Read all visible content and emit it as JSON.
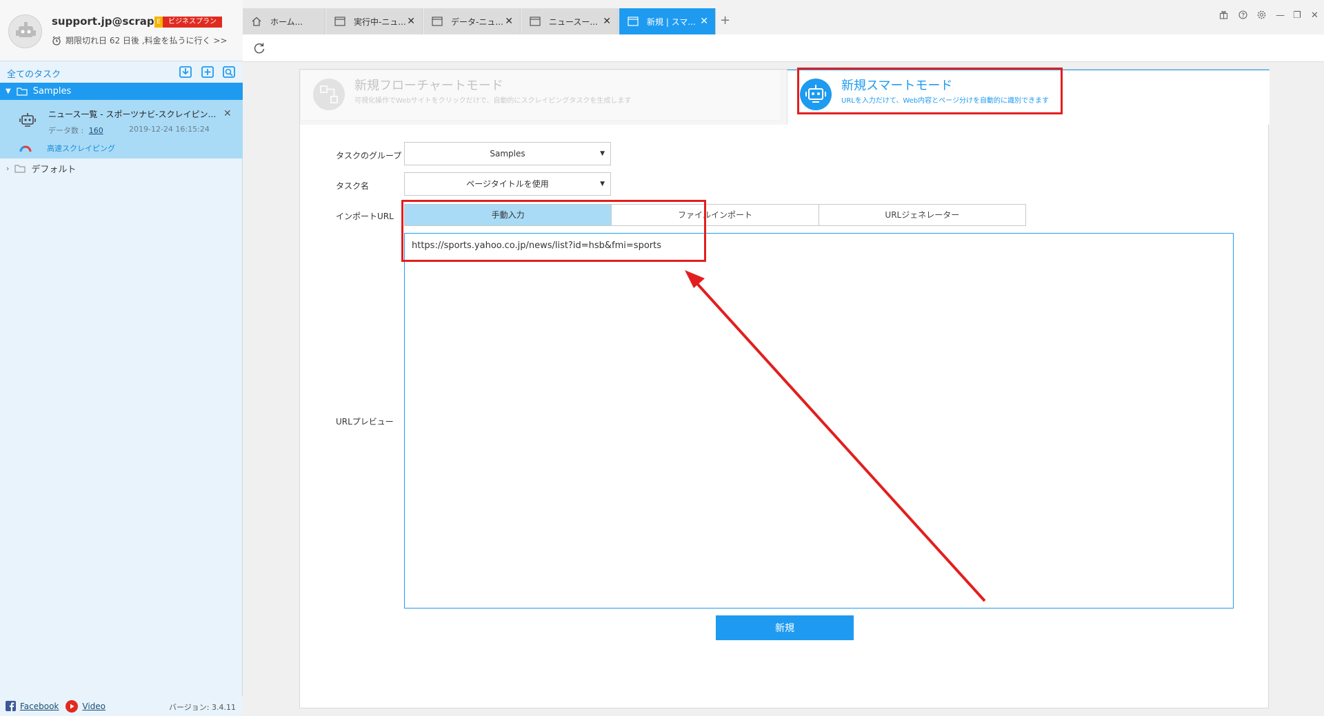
{
  "account": {
    "email": "support.jp@scrap…",
    "plan_letter": "E",
    "plan": "ビジネスプラン",
    "expiry": "期限切れ日 62 日後 ,料金を払うに行く >>"
  },
  "sidebar": {
    "all_tasks": "全てのタスク",
    "groups": [
      {
        "label": "Samples"
      },
      {
        "label": "デフォルト"
      }
    ],
    "task": {
      "title": "ニュース一覧 - スポーツナビ-スクレイピン…",
      "data_label": "データ数 :",
      "data_count": "160",
      "date": "2019-12-24 16:15:24",
      "speed": "高速スクレイピング"
    },
    "footer": {
      "facebook": "Facebook",
      "video": "Video",
      "version": "バージョン: 3.4.11"
    }
  },
  "tabs": [
    {
      "label": "ホーム..."
    },
    {
      "label": "実行中-ニュ..."
    },
    {
      "label": "データ-ニュ..."
    },
    {
      "label": "ニュースー..."
    },
    {
      "label": "新規 | スマ..."
    }
  ],
  "modes": {
    "flow": {
      "title": "新規フローチャートモード",
      "desc": "可視化操作でWebサイトをクリックだけで、自動的にスクレイピングタスクを生成します"
    },
    "smart": {
      "title": "新規スマートモード",
      "desc": "URLを入力だけて、Web内容とページ分けを自動的に識別できます"
    }
  },
  "form": {
    "group_label": "タスクのグループ",
    "group_value": "Samples",
    "name_label": "タスク名",
    "name_value": "ページタイトルを使用",
    "import_label": "インポートURL",
    "import_tabs": [
      "手動入力",
      "ファイルインポート",
      "URLジェネレーター"
    ],
    "preview_label": "URLプレビュー",
    "url_value": "https://sports.yahoo.co.jp/news/list?id=hsb&fmi=sports",
    "create_label": "新規"
  },
  "colors": {
    "accent": "#1e9bf0",
    "selected": "#a9dbf7",
    "annotation": "#e31e1e",
    "plan_badge": "#e02a20"
  }
}
